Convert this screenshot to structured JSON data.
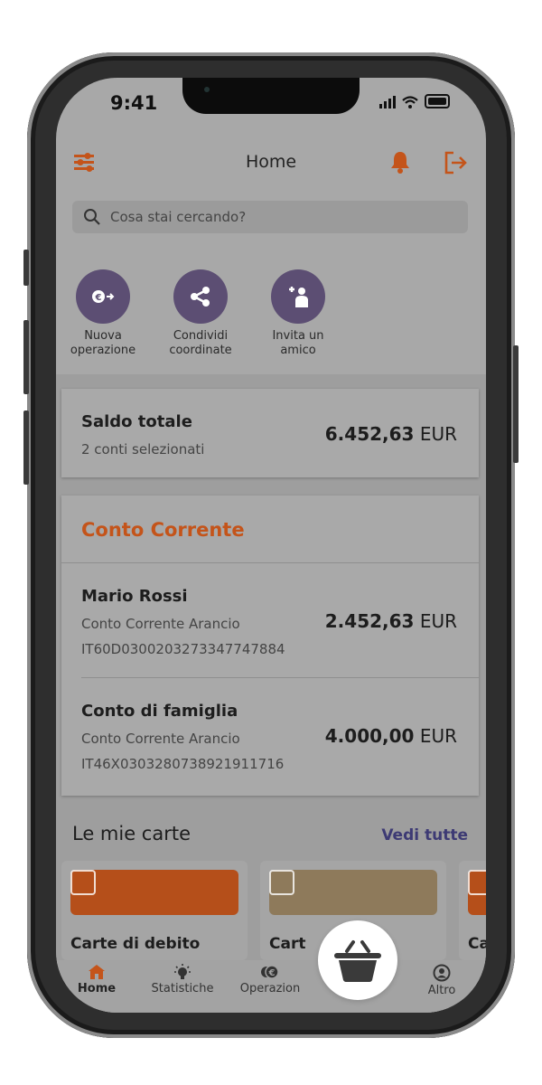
{
  "status": {
    "time": "9:41"
  },
  "header": {
    "title": "Home"
  },
  "search": {
    "placeholder": "Cosa stai cercando?"
  },
  "quick_actions": [
    {
      "label": "Nuova operazione",
      "icon": "euro-transfer-icon"
    },
    {
      "label": "Condividi coordinate",
      "icon": "share-icon"
    },
    {
      "label": "Invita un amico",
      "icon": "add-friend-icon"
    }
  ],
  "summary": {
    "title": "Saldo totale",
    "subtitle": "2 conti selezionati",
    "amount": "6.452,63",
    "currency": "EUR"
  },
  "account_section": {
    "title": "Conto Corrente",
    "accounts": [
      {
        "name": "Mario Rossi",
        "type": "Conto Corrente Arancio",
        "iban": "IT60D0300203273347747884",
        "amount": "2.452,63",
        "currency": "EUR"
      },
      {
        "name": "Conto di famiglia",
        "type": "Conto Corrente Arancio",
        "iban": "IT46X0303280738921911716",
        "amount": "4.000,00",
        "currency": "EUR"
      }
    ]
  },
  "cards_section": {
    "title": "Le mie carte",
    "link": "Vedi tutte",
    "cards": [
      {
        "name": "Carte di debito",
        "color": "#b54f1a"
      },
      {
        "name": "Cart",
        "color": "#8e7a5b"
      },
      {
        "name": "Ca",
        "color": "#b54f1a"
      }
    ]
  },
  "tabs": [
    {
      "label": "Home",
      "icon": "home-icon",
      "active": true
    },
    {
      "label": "Statistiche",
      "icon": "lightbulb-icon",
      "active": false
    },
    {
      "label": "Operazion",
      "icon": "euro-coins-icon",
      "active": false
    },
    {
      "label": "Altro",
      "icon": "profile-icon",
      "active": false
    }
  ],
  "colors": {
    "accent": "#c4541a",
    "purple": "#5c4e73",
    "link": "#3d3a74"
  }
}
